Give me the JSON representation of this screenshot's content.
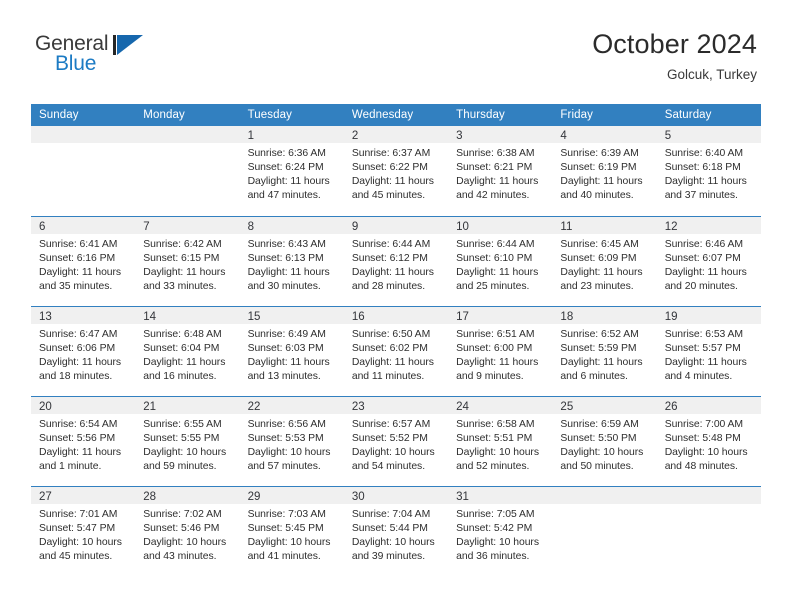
{
  "brand": {
    "name_line1": "General",
    "name_line2": "Blue",
    "mark": "triangle-logo",
    "color_dark": "#262626",
    "color_blue": "#1667ad"
  },
  "header": {
    "title": "October 2024",
    "subtitle": "Golcuk, Turkey"
  },
  "theme": {
    "header_blue": "#3280c0",
    "band_gray": "#f0f0f0",
    "text_dark": "#2e2e2e"
  },
  "calendar": {
    "weekday_headers": [
      "Sunday",
      "Monday",
      "Tuesday",
      "Wednesday",
      "Thursday",
      "Friday",
      "Saturday"
    ],
    "weeks": [
      [
        {
          "day": "",
          "lines": []
        },
        {
          "day": "",
          "lines": []
        },
        {
          "day": "1",
          "lines": [
            "Sunrise: 6:36 AM",
            "Sunset: 6:24 PM",
            "Daylight: 11 hours",
            "and 47 minutes."
          ]
        },
        {
          "day": "2",
          "lines": [
            "Sunrise: 6:37 AM",
            "Sunset: 6:22 PM",
            "Daylight: 11 hours",
            "and 45 minutes."
          ]
        },
        {
          "day": "3",
          "lines": [
            "Sunrise: 6:38 AM",
            "Sunset: 6:21 PM",
            "Daylight: 11 hours",
            "and 42 minutes."
          ]
        },
        {
          "day": "4",
          "lines": [
            "Sunrise: 6:39 AM",
            "Sunset: 6:19 PM",
            "Daylight: 11 hours",
            "and 40 minutes."
          ]
        },
        {
          "day": "5",
          "lines": [
            "Sunrise: 6:40 AM",
            "Sunset: 6:18 PM",
            "Daylight: 11 hours",
            "and 37 minutes."
          ]
        }
      ],
      [
        {
          "day": "6",
          "lines": [
            "Sunrise: 6:41 AM",
            "Sunset: 6:16 PM",
            "Daylight: 11 hours",
            "and 35 minutes."
          ]
        },
        {
          "day": "7",
          "lines": [
            "Sunrise: 6:42 AM",
            "Sunset: 6:15 PM",
            "Daylight: 11 hours",
            "and 33 minutes."
          ]
        },
        {
          "day": "8",
          "lines": [
            "Sunrise: 6:43 AM",
            "Sunset: 6:13 PM",
            "Daylight: 11 hours",
            "and 30 minutes."
          ]
        },
        {
          "day": "9",
          "lines": [
            "Sunrise: 6:44 AM",
            "Sunset: 6:12 PM",
            "Daylight: 11 hours",
            "and 28 minutes."
          ]
        },
        {
          "day": "10",
          "lines": [
            "Sunrise: 6:44 AM",
            "Sunset: 6:10 PM",
            "Daylight: 11 hours",
            "and 25 minutes."
          ]
        },
        {
          "day": "11",
          "lines": [
            "Sunrise: 6:45 AM",
            "Sunset: 6:09 PM",
            "Daylight: 11 hours",
            "and 23 minutes."
          ]
        },
        {
          "day": "12",
          "lines": [
            "Sunrise: 6:46 AM",
            "Sunset: 6:07 PM",
            "Daylight: 11 hours",
            "and 20 minutes."
          ]
        }
      ],
      [
        {
          "day": "13",
          "lines": [
            "Sunrise: 6:47 AM",
            "Sunset: 6:06 PM",
            "Daylight: 11 hours",
            "and 18 minutes."
          ]
        },
        {
          "day": "14",
          "lines": [
            "Sunrise: 6:48 AM",
            "Sunset: 6:04 PM",
            "Daylight: 11 hours",
            "and 16 minutes."
          ]
        },
        {
          "day": "15",
          "lines": [
            "Sunrise: 6:49 AM",
            "Sunset: 6:03 PM",
            "Daylight: 11 hours",
            "and 13 minutes."
          ]
        },
        {
          "day": "16",
          "lines": [
            "Sunrise: 6:50 AM",
            "Sunset: 6:02 PM",
            "Daylight: 11 hours",
            "and 11 minutes."
          ]
        },
        {
          "day": "17",
          "lines": [
            "Sunrise: 6:51 AM",
            "Sunset: 6:00 PM",
            "Daylight: 11 hours",
            "and 9 minutes."
          ]
        },
        {
          "day": "18",
          "lines": [
            "Sunrise: 6:52 AM",
            "Sunset: 5:59 PM",
            "Daylight: 11 hours",
            "and 6 minutes."
          ]
        },
        {
          "day": "19",
          "lines": [
            "Sunrise: 6:53 AM",
            "Sunset: 5:57 PM",
            "Daylight: 11 hours",
            "and 4 minutes."
          ]
        }
      ],
      [
        {
          "day": "20",
          "lines": [
            "Sunrise: 6:54 AM",
            "Sunset: 5:56 PM",
            "Daylight: 11 hours",
            "and 1 minute."
          ]
        },
        {
          "day": "21",
          "lines": [
            "Sunrise: 6:55 AM",
            "Sunset: 5:55 PM",
            "Daylight: 10 hours",
            "and 59 minutes."
          ]
        },
        {
          "day": "22",
          "lines": [
            "Sunrise: 6:56 AM",
            "Sunset: 5:53 PM",
            "Daylight: 10 hours",
            "and 57 minutes."
          ]
        },
        {
          "day": "23",
          "lines": [
            "Sunrise: 6:57 AM",
            "Sunset: 5:52 PM",
            "Daylight: 10 hours",
            "and 54 minutes."
          ]
        },
        {
          "day": "24",
          "lines": [
            "Sunrise: 6:58 AM",
            "Sunset: 5:51 PM",
            "Daylight: 10 hours",
            "and 52 minutes."
          ]
        },
        {
          "day": "25",
          "lines": [
            "Sunrise: 6:59 AM",
            "Sunset: 5:50 PM",
            "Daylight: 10 hours",
            "and 50 minutes."
          ]
        },
        {
          "day": "26",
          "lines": [
            "Sunrise: 7:00 AM",
            "Sunset: 5:48 PM",
            "Daylight: 10 hours",
            "and 48 minutes."
          ]
        }
      ],
      [
        {
          "day": "27",
          "lines": [
            "Sunrise: 7:01 AM",
            "Sunset: 5:47 PM",
            "Daylight: 10 hours",
            "and 45 minutes."
          ]
        },
        {
          "day": "28",
          "lines": [
            "Sunrise: 7:02 AM",
            "Sunset: 5:46 PM",
            "Daylight: 10 hours",
            "and 43 minutes."
          ]
        },
        {
          "day": "29",
          "lines": [
            "Sunrise: 7:03 AM",
            "Sunset: 5:45 PM",
            "Daylight: 10 hours",
            "and 41 minutes."
          ]
        },
        {
          "day": "30",
          "lines": [
            "Sunrise: 7:04 AM",
            "Sunset: 5:44 PM",
            "Daylight: 10 hours",
            "and 39 minutes."
          ]
        },
        {
          "day": "31",
          "lines": [
            "Sunrise: 7:05 AM",
            "Sunset: 5:42 PM",
            "Daylight: 10 hours",
            "and 36 minutes."
          ]
        },
        {
          "day": "",
          "lines": []
        },
        {
          "day": "",
          "lines": []
        }
      ]
    ]
  }
}
